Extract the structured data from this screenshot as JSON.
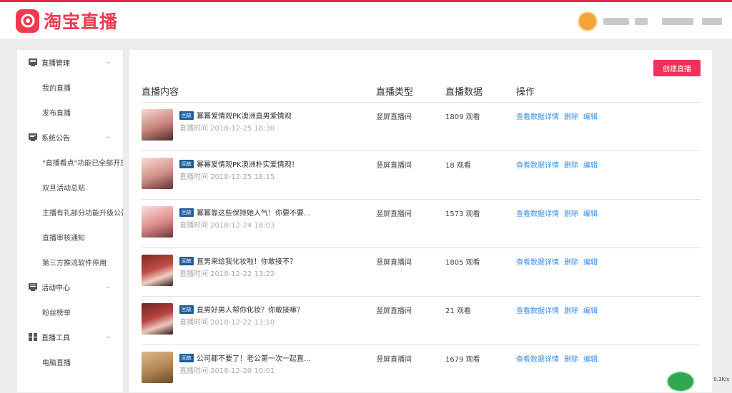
{
  "colors": {
    "brand": "#f03a4f",
    "accent_blue": "#3a8ee6",
    "tag_blue": "#1c5c9c"
  },
  "header": {
    "logo_text": "淘宝直播"
  },
  "sidebar": {
    "groups": [
      {
        "label": "直播管理",
        "icon": "live-manage-icon",
        "items": [
          "我的直播",
          "发布直播"
        ]
      },
      {
        "label": "系统公告",
        "icon": "announcement-icon",
        "items": [
          "\"直播看点\"功能已全部开放",
          "双旦活动总贴",
          "主播有礼部分功能升级公告",
          "直播审核通知",
          "第三方推流软件停用"
        ]
      },
      {
        "label": "活动中心",
        "icon": "activity-icon",
        "items": [
          "粉丝榜单"
        ]
      },
      {
        "label": "直播工具",
        "icon": "tools-icon",
        "items": [
          "电脑直播"
        ]
      }
    ]
  },
  "main": {
    "create_button": "创建直播",
    "columns": [
      "直播内容",
      "直播类型",
      "直播数据",
      "操作"
    ],
    "ops": [
      "查看数据详情",
      "删除",
      "编辑"
    ],
    "rows": [
      {
        "tag": "回放",
        "title": "幂幂爱情观PK澳洲直男爱情观",
        "time": "直播时间 2018-12-25 18:30",
        "type": "竖屏直播间",
        "views": "1809 观看"
      },
      {
        "tag": "回放",
        "title": "幂幂爱情观PK澳洲朴实爱情观！",
        "time": "直播时间 2018-12-25 18:15",
        "type": "竖屏直播间",
        "views": "18 观看"
      },
      {
        "tag": "回放",
        "title": "幂幂靠这些保持她人气！你要不要...",
        "time": "直播时间 2018-12-24 18:03",
        "type": "竖屏直播间",
        "views": "1573 观看"
      },
      {
        "tag": "回放",
        "title": "直男来给我化妆啦！你敢接不？",
        "time": "直播时间 2018-12-22 13:22",
        "type": "竖屏直播间",
        "views": "1805 观看"
      },
      {
        "tag": "回放",
        "title": "直男好男人帮你化妆？你敢接嘛？",
        "time": "直播时间 2018-12-22 13:10",
        "type": "竖屏直播间",
        "views": "21 观看"
      },
      {
        "tag": "回放",
        "title": "公司都不要了！老公第一次一起直...",
        "time": "直播时间 2018-12-20 10:01",
        "type": "竖屏直播间",
        "views": "1679 观看"
      }
    ]
  },
  "status": {
    "net_speed": "0.3K/s"
  }
}
